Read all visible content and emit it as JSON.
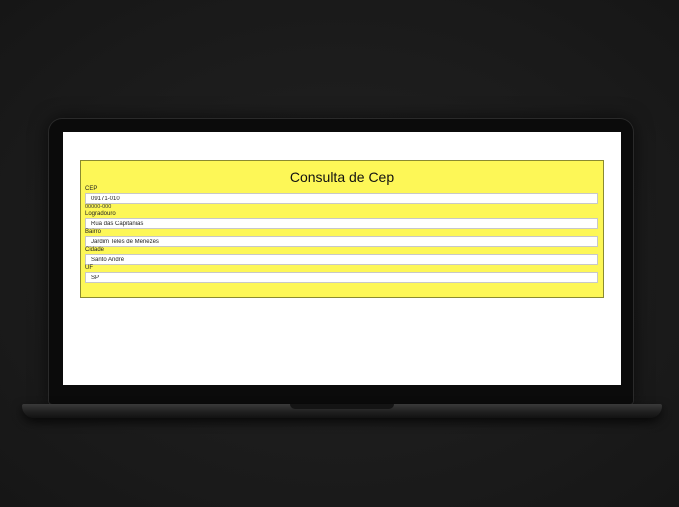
{
  "form": {
    "title": "Consulta de Cep",
    "fields": {
      "cep": {
        "label": "CEP",
        "value": "09171-010",
        "hint": "00000-000"
      },
      "logradouro": {
        "label": "Logradouro",
        "value": "Rua das Capitanias"
      },
      "bairro": {
        "label": "Bairro",
        "value": "Jardim Teles de Menezes"
      },
      "cidade": {
        "label": "Cidade",
        "value": "Santo André"
      },
      "uf": {
        "label": "UF",
        "value": "SP"
      }
    }
  },
  "colors": {
    "card_background": "#fdf757",
    "page_background": "#ffffff",
    "device_frame": "#0b0b0b"
  }
}
